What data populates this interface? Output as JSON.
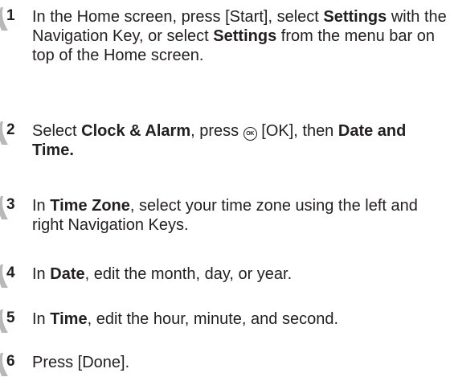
{
  "steps": [
    {
      "number": "1",
      "parts": [
        {
          "t": "In the Home screen, press [Start], select "
        },
        {
          "t": "Settings",
          "b": true
        },
        {
          "t": " with the Navigation Key, or select "
        },
        {
          "t": "Settings",
          "b": true
        },
        {
          "t": " from the menu bar on top of the Home screen."
        }
      ]
    },
    {
      "number": "2",
      "parts": [
        {
          "t": "Select "
        },
        {
          "t": "Clock & Alarm",
          "b": true
        },
        {
          "t": ", press "
        },
        {
          "icon": "ok-key-icon",
          "label": "OK"
        },
        {
          "t": " [OK], then "
        },
        {
          "t": "Date and Time.",
          "b": true
        }
      ]
    },
    {
      "number": "3",
      "parts": [
        {
          "t": "In "
        },
        {
          "t": "Time Zone",
          "b": true
        },
        {
          "t": ", select your time zone using the left and right Navigation Keys."
        }
      ]
    },
    {
      "number": "4",
      "parts": [
        {
          "t": "In "
        },
        {
          "t": "Date",
          "b": true
        },
        {
          "t": ", edit the month, day, or year."
        }
      ]
    },
    {
      "number": "5",
      "parts": [
        {
          "t": "In "
        },
        {
          "t": "Time",
          "b": true
        },
        {
          "t": ", edit the hour, minute, and second."
        }
      ]
    },
    {
      "number": "6",
      "parts": [
        {
          "t": "Press [Done]."
        }
      ]
    }
  ]
}
